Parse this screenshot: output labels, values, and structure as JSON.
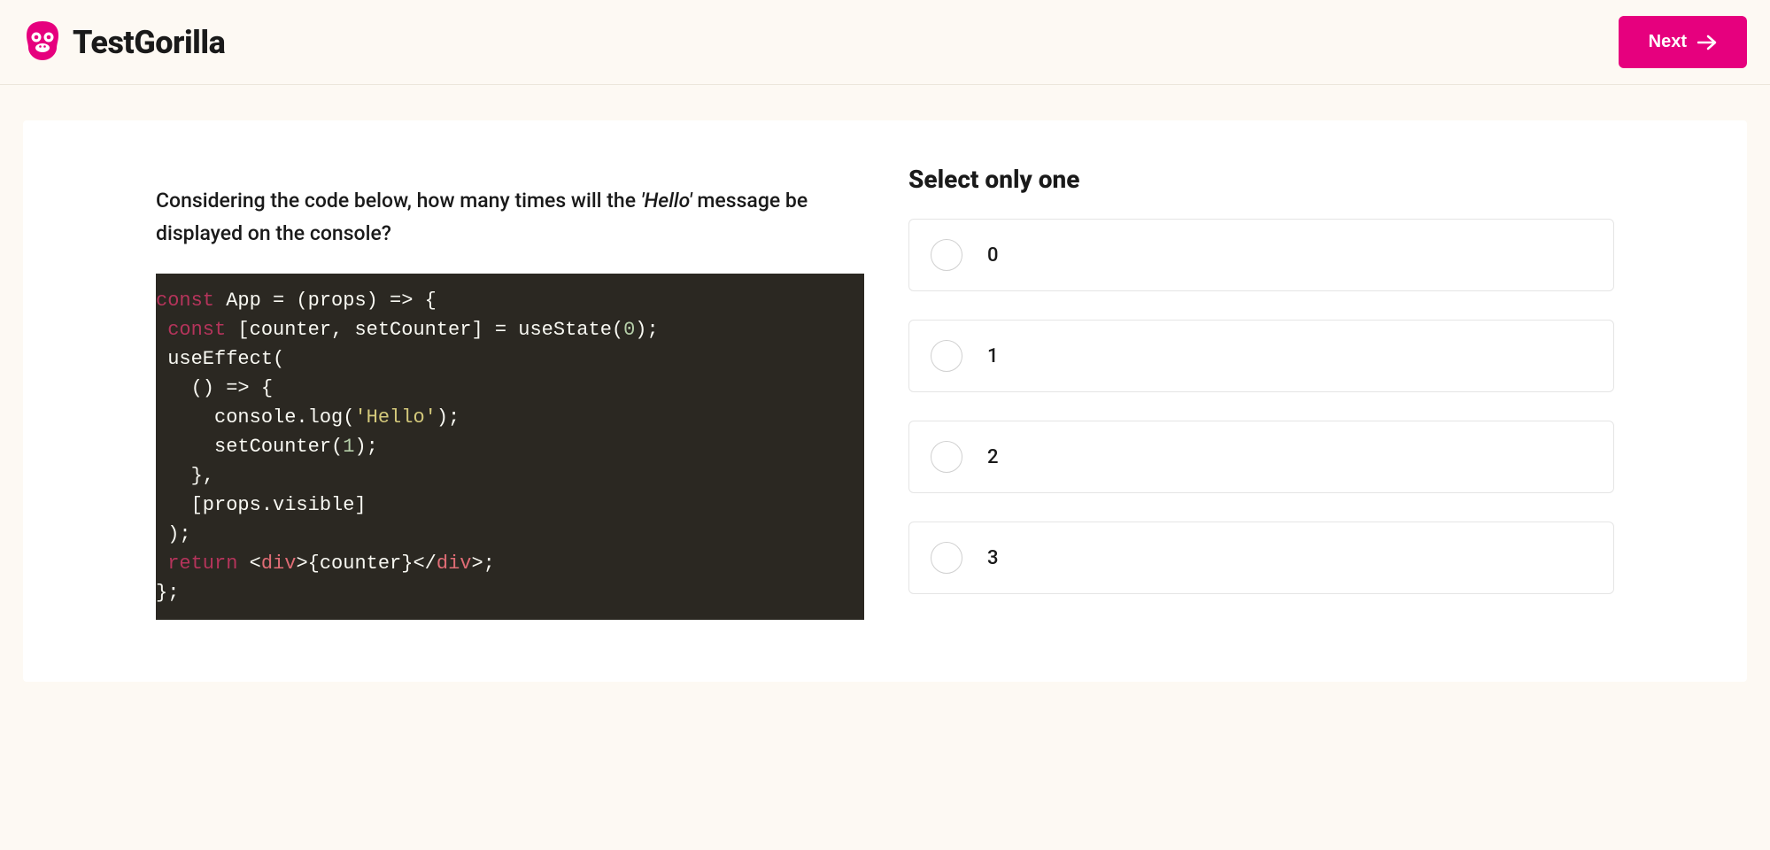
{
  "header": {
    "brand": "TestGorilla",
    "next_label": "Next"
  },
  "question": {
    "prefix": "Considering the code below, how many times will the ",
    "emph": "'Hello'",
    "suffix": " message be displayed on the console?"
  },
  "code": {
    "tokens": [
      [
        [
          "kw",
          "const"
        ],
        [
          "pn",
          " App = (props) => {"
        ]
      ],
      [
        [
          "pn",
          " "
        ],
        [
          "kw",
          "const"
        ],
        [
          "pn",
          " [counter, setCounter] = useState("
        ],
        [
          "num",
          "0"
        ],
        [
          "pn",
          ");"
        ]
      ],
      [
        [
          "pn",
          " useEffect("
        ]
      ],
      [
        [
          "pn",
          "   () => {"
        ]
      ],
      [
        [
          "pn",
          "     console.log("
        ],
        [
          "str",
          "'Hello'"
        ],
        [
          "pn",
          ");"
        ]
      ],
      [
        [
          "pn",
          "     setCounter("
        ],
        [
          "num",
          "1"
        ],
        [
          "pn",
          ");"
        ]
      ],
      [
        [
          "pn",
          "   },"
        ]
      ],
      [
        [
          "pn",
          "   [props.visible]"
        ]
      ],
      [
        [
          "pn",
          " );"
        ]
      ],
      [
        [
          "pn",
          " "
        ],
        [
          "kw",
          "return"
        ],
        [
          "pn",
          " <"
        ],
        [
          "tag",
          "div"
        ],
        [
          "pn",
          ">{counter}</"
        ],
        [
          "tag",
          "div"
        ],
        [
          "pn",
          ">;"
        ]
      ],
      [
        [
          "pn",
          "};"
        ]
      ]
    ]
  },
  "answers": {
    "instruction": "Select only one",
    "options": [
      "0",
      "1",
      "2",
      "3"
    ]
  }
}
